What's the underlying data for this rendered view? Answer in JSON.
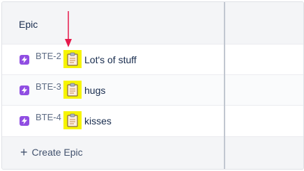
{
  "header": {
    "title": "Epic"
  },
  "rows": [
    {
      "key": "BTE-2",
      "summary": "Lot's of stuff",
      "icon": "clipboard-icon"
    },
    {
      "key": "BTE-3",
      "summary": "hugs",
      "icon": "clipboard-icon"
    },
    {
      "key": "BTE-4",
      "summary": "kisses",
      "icon": "clipboard-icon"
    }
  ],
  "create": {
    "label": "Create Epic"
  },
  "colors": {
    "epic_icon": "#904ee2",
    "highlight": "#f6f400",
    "arrow": "#e6194b"
  }
}
